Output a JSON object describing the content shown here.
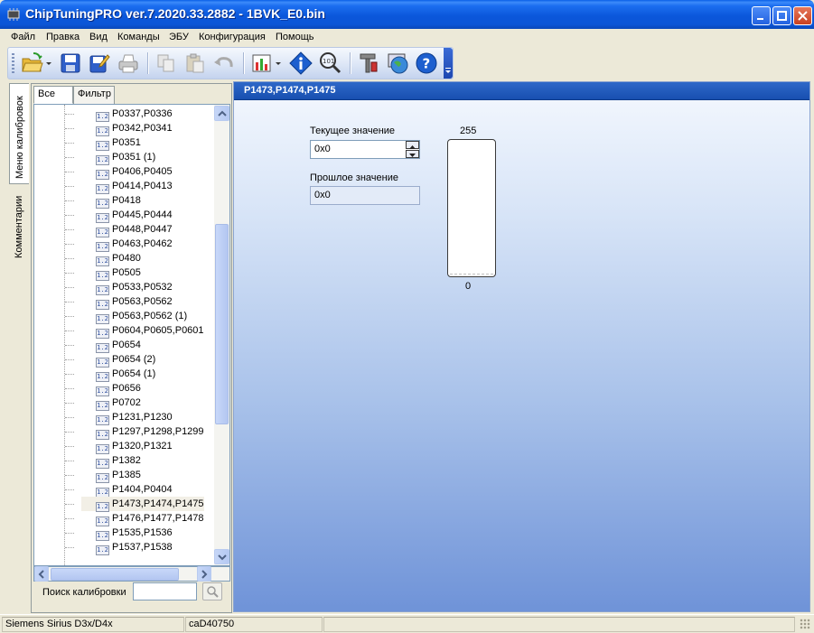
{
  "window": {
    "title": "ChipTuningPRO ver.7.2020.33.2882 - 1BVK_E0.bin"
  },
  "menu": [
    "Файл",
    "Правка",
    "Вид",
    "Команды",
    "ЭБУ",
    "Конфигурация",
    "Помощь"
  ],
  "toolbar": {
    "icons": [
      "open-folder-icon",
      "save-icon",
      "save-as-icon",
      "print-icon",
      "copy-icon",
      "paste-icon",
      "undo-icon",
      "chart-icon",
      "info-icon",
      "search-zoom-icon",
      "tools-icon",
      "globe-icon",
      "help-icon"
    ]
  },
  "side_tabs": {
    "calibration_menu": "Меню калибровок",
    "comments": "Комментарии"
  },
  "left_panel": {
    "tab_all": "Все",
    "tab_filter": "Фильтр",
    "icon_text": "1.2",
    "selected_index": 27,
    "items": [
      "P0337,P0336",
      "P0342,P0341",
      "P0351",
      "P0351 (1)",
      "P0406,P0405",
      "P0414,P0413",
      "P0418",
      "P0445,P0444",
      "P0448,P0447",
      "P0463,P0462",
      "P0480",
      "P0505",
      "P0533,P0532",
      "P0563,P0562",
      "P0563,P0562 (1)",
      "P0604,P0605,P0601",
      "P0654",
      "P0654 (2)",
      "P0654 (1)",
      "P0656",
      "P0702",
      "P1231,P1230",
      "P1297,P1298,P1299",
      "P1320,P1321",
      "P1382",
      "P1385",
      "P1404,P0404",
      "P1473,P1474,P1475",
      "P1476,P1477,P1478",
      "P1535,P1536",
      "P1537,P1538"
    ],
    "search_label": "Поиск калибровки",
    "search_value": ""
  },
  "right_panel": {
    "title": "P1473,P1474,P1475",
    "current_label": "Текущее значение",
    "current_value": "0x0",
    "previous_label": "Прошлое значение",
    "previous_value": "0x0",
    "gauge_max": "255",
    "gauge_min": "0",
    "gauge_level": 0
  },
  "status": {
    "ecu": "Siemens Sirius D3x/D4x",
    "code": "caD40750"
  },
  "colors": {
    "title_bar": "#0b57db",
    "header_bar": "#2e68c8",
    "panel_gradient_bottom": "#6f93d8"
  }
}
